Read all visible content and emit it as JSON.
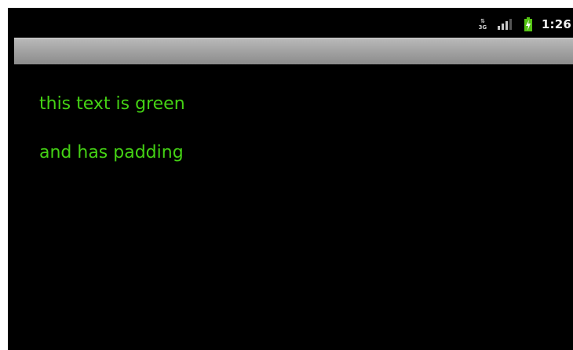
{
  "status_bar": {
    "network_top": "⇅",
    "network_type": "3G",
    "time": "1:26",
    "battery_color": "#55c414"
  },
  "content": {
    "lines": [
      "this text is green",
      "and has padding"
    ],
    "text_color": "#44d214"
  },
  "colors": {
    "background": "#000000",
    "title_bar": "#a6a6a6"
  }
}
